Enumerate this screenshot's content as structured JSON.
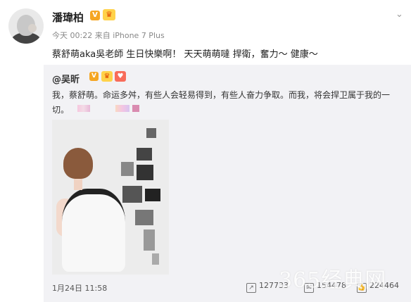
{
  "post": {
    "username": "潘瑋柏",
    "meta": "今天 00:22 来自 iPhone 7 Plus",
    "text": "蔡舒萌aka吳老師 生日快樂啊！ 天天萌萌噠 捍衛，奮力～ 健康～"
  },
  "quoted": {
    "username": "@吴昕",
    "text": "我，蔡舒萌。命运多舛，有些人会轻易得到，有些人奋力争取。而我，将会捍卫属于我的一切。",
    "date": "1月24日 11:58",
    "shares": "127733",
    "comments": "154478",
    "likes": "224464"
  },
  "watermark": "365经典网",
  "colors": {
    "quote_bg": "#f2f2f5",
    "badge_orange": "#f5a623",
    "badge_yellow": "#ffd24a",
    "badge_red": "#f86c5a"
  }
}
